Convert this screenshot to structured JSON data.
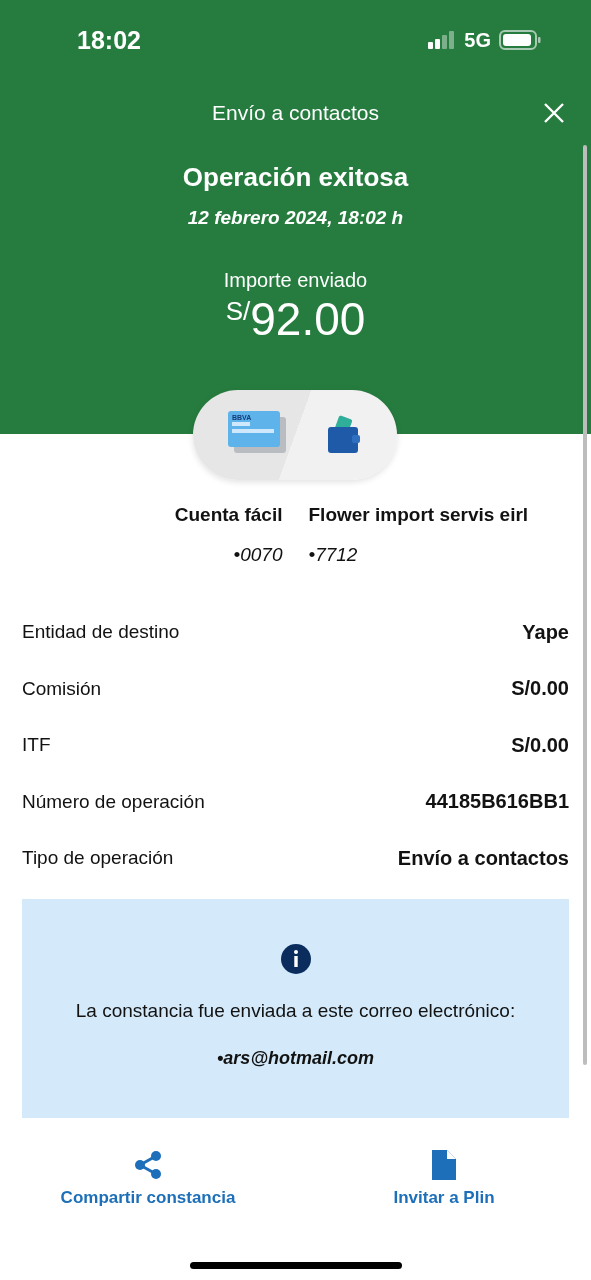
{
  "status_bar": {
    "time": "18:02",
    "network": "5G"
  },
  "header": {
    "title": "Envío a contactos",
    "heading": "Operación exitosa",
    "date": "12 febrero 2024, 18:02 h",
    "amount_label": "Importe enviado",
    "currency": "S/",
    "amount": "92.00"
  },
  "card_logo": "BBVA",
  "accounts": [
    {
      "name": "Cuenta fácil",
      "number": "•0070"
    },
    {
      "name": "Flower import servis eirl",
      "number": "•7712"
    }
  ],
  "details": [
    {
      "label": "Entidad de destino",
      "value": "Yape"
    },
    {
      "label": "Comisión",
      "value": "S/0.00"
    },
    {
      "label": "ITF",
      "value": "S/0.00"
    },
    {
      "label": "Número de operación",
      "value": "44185B616BB1"
    },
    {
      "label": "Tipo de operación",
      "value": "Envío a contactos"
    }
  ],
  "notice": {
    "text": "La constancia fue enviada a este correo electrónico:",
    "email": "•ars@hotmail.com"
  },
  "actions": [
    {
      "kind": "share",
      "label": "Compartir constancia"
    },
    {
      "kind": "document",
      "label": "Invitar a Plin"
    }
  ]
}
